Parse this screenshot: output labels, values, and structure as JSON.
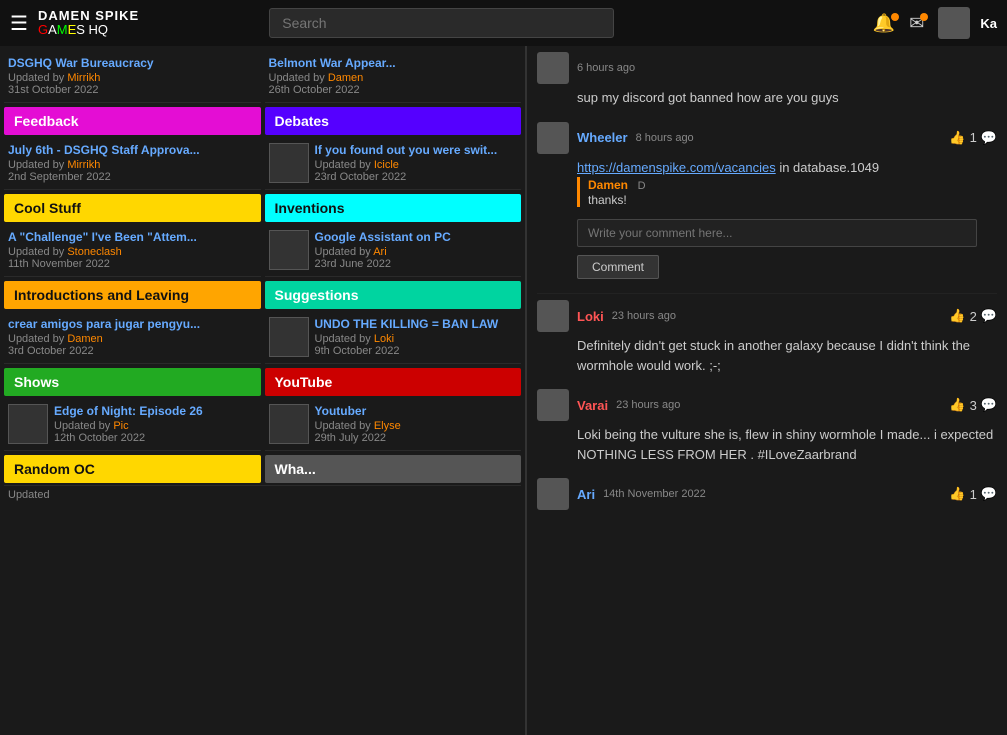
{
  "nav": {
    "hamburger": "☰",
    "logo_top": "DAMEN SPIKE",
    "logo_bottom_g": "G",
    "logo_bottom_a": "A",
    "logo_bottom_m": "M",
    "logo_bottom_e": "E",
    "logo_bottom_s": "S",
    "logo_bottom_hq": " HQ",
    "search_placeholder": "Search",
    "user": "Ka"
  },
  "sections": {
    "feedback": "Feedback",
    "debates": "Debates",
    "coolstuff": "Cool Stuff",
    "inventions": "Inventions",
    "introductions": "Introductions and Leaving",
    "suggestions": "Suggestions",
    "shows": "Shows",
    "youtube": "YouTube",
    "random": "Random OC"
  },
  "posts": {
    "feedback_post": {
      "title": "July 6th - DSGHQ Staff Approva...",
      "meta_pre": "Updated by ",
      "author": "Mirrikh",
      "date": "2nd September 2022"
    },
    "debates_post": {
      "title": "If you found out you were swit...",
      "meta_pre": "Updated by ",
      "author": "Icicle",
      "date": "23rd October 2022"
    },
    "coolstuff_pre": {
      "title": "DSGHQ War Bureaucracy",
      "meta_pre": "Updated by ",
      "author": "Mirrikh",
      "date": "31st October 2022"
    },
    "debates_pre": {
      "title": "Belmont War Appear...",
      "meta_pre": "Updated by ",
      "author": "Damen",
      "date": "26th October 2022"
    },
    "coolstuff_post": {
      "title": "A \"Challenge\" I've Been \"Attem...",
      "meta_pre": "Updated by ",
      "author": "Stoneclash",
      "date": "11th November 2022"
    },
    "inventions_post": {
      "title": "Google Assistant on PC",
      "meta_pre": "Updated by ",
      "author": "Ari",
      "date": "23rd June 2022"
    },
    "intro_post": {
      "title": "crear amigos para jugar pengyu...",
      "meta_pre": "Updated by ",
      "author": "Damen",
      "date": "3rd October 2022"
    },
    "suggestions_post": {
      "title": "UNDO THE KILLING = BAN LAW",
      "meta_pre": "Updated by ",
      "author": "Loki",
      "date": "9th October 2022"
    },
    "shows_post": {
      "title": "Edge of Night: Episode 26",
      "meta_pre": "Updated by ",
      "author": "Pic",
      "date": "12th October 2022"
    },
    "youtube_post": {
      "title": "Youtuber",
      "meta_pre": "Updated by ",
      "author": "Elyse",
      "date": "29th July 2022"
    }
  },
  "update_bar": "Updated",
  "chat": {
    "msg0": {
      "time": "6 hours ago",
      "text": "sup my discord got banned how are you guys"
    },
    "msg1": {
      "username": "Wheeler",
      "username_color": "#6af",
      "time": "8 hours ago",
      "likes": "1",
      "text": "https://damenspike.com/vacancies in database.1049"
    },
    "reply_name": "Damen",
    "reply_text": "thanks!",
    "comment_placeholder": "Write your comment here...",
    "comment_btn": "Comment",
    "msg2": {
      "username": "Loki",
      "username_color": "#f55",
      "time": "23 hours ago",
      "likes": "2",
      "text": "Definitely didn't get stuck in another galaxy because I didn't think the wormhole would work. ;-;"
    },
    "msg3": {
      "username": "Varai",
      "username_color": "#f55",
      "time": "23 hours ago",
      "likes": "3",
      "text": "Loki being the vulture she is, flew in shiny wormhole I made... i expected NOTHING LESS FROM HER . #ILoveZaarbrand"
    },
    "msg4": {
      "username": "Ari",
      "username_color": "#6af",
      "time": "14th November 2022",
      "likes": "1",
      "text": ""
    }
  }
}
